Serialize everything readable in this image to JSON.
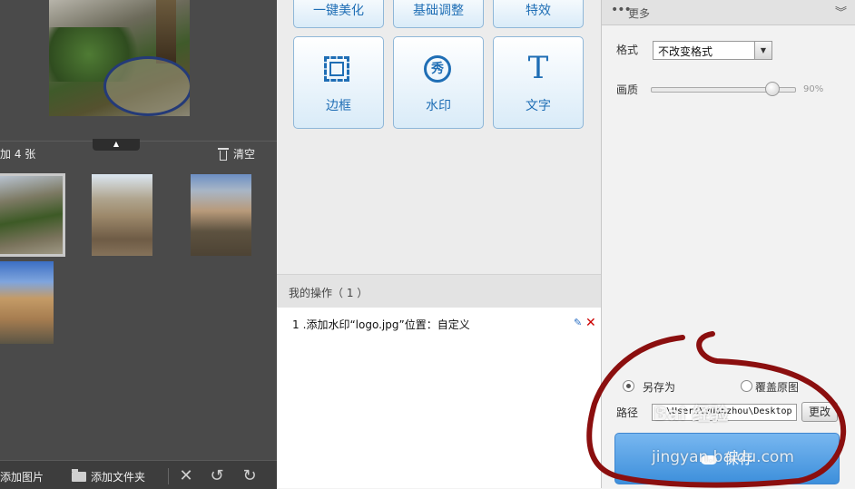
{
  "left_panel": {
    "count_label": "加 4 张",
    "clear_label": "清空",
    "add_image_label": "添加图片",
    "add_folder_label": "添加文件夹"
  },
  "tools": {
    "row1": [
      "一键美化",
      "基础调整",
      "特效"
    ],
    "border_label": "边框",
    "watermark_label": "水印",
    "watermark_glyph": "秀",
    "text_label": "文字",
    "text_glyph": "T"
  },
  "operations": {
    "title": "我的操作（ 1 ）",
    "items": [
      {
        "num": "1",
        "text": ".添加水印“logo.jpg”位置：自定义"
      }
    ]
  },
  "settings": {
    "more_title": "更多",
    "format_label": "格式",
    "format_value": "不改变格式",
    "quality_label": "画质",
    "quality_value": "90%",
    "save_as_label": "另存为",
    "overwrite_label": "覆盖原图",
    "path_label": "路径",
    "path_value": "C:\\Users\\yuanzhou\\Desktop",
    "change_label": "更改",
    "save_label": "保存"
  },
  "watermark": {
    "line1": "Bai 经验",
    "line2": "jingyan.baidu.com"
  },
  "colors": {
    "accent": "#1f6eb5",
    "annotation": "#8b0f0f"
  }
}
